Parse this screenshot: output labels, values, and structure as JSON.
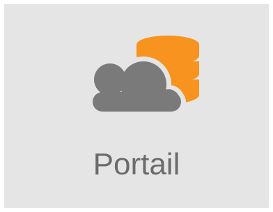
{
  "tile": {
    "label": "Portail",
    "icon": "cloud-database-icon",
    "colors": {
      "background": "#e5e5e5",
      "cloud": "#7a7a7a",
      "database": "#f7931e",
      "label": "#6b6b6b"
    }
  }
}
